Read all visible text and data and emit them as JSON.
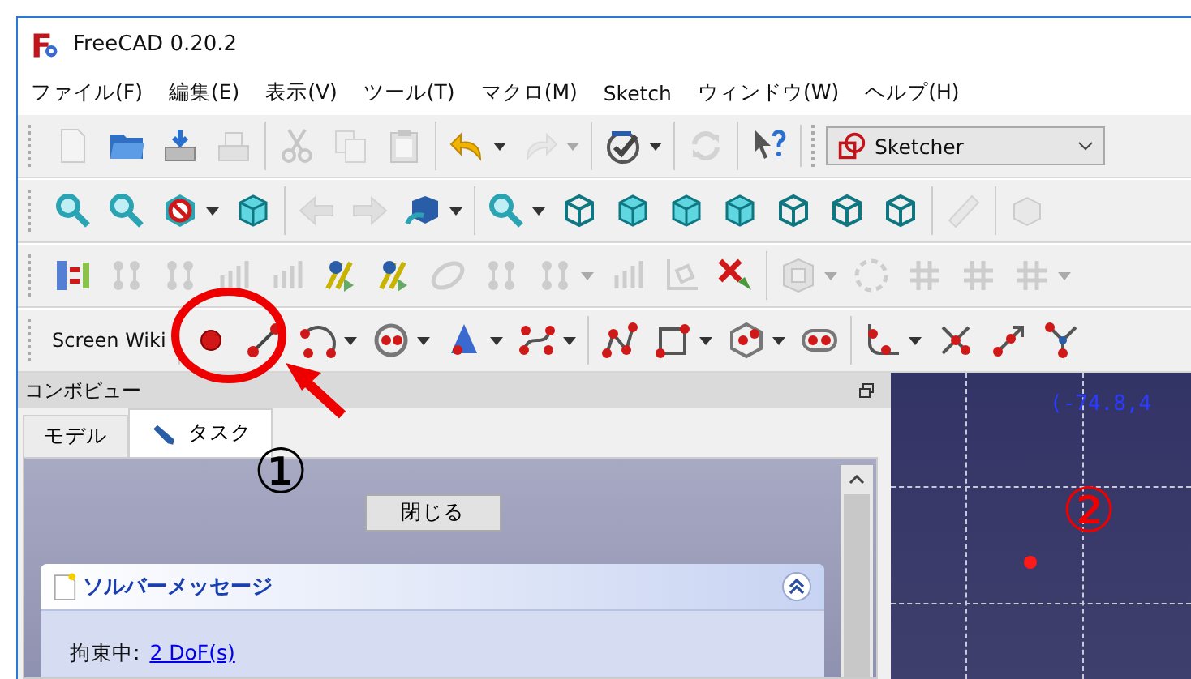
{
  "window": {
    "title": "FreeCAD 0.20.2"
  },
  "menu": [
    "ファイル(F)",
    "編集(E)",
    "表示(V)",
    "ツール(T)",
    "マクロ(M)",
    "Sketch",
    "ウィンドウ(W)",
    "ヘルプ(H)"
  ],
  "toolbars": [
    {
      "groups": [
        [
          {
            "disabled": true,
            "dropdown": false
          },
          {
            "disabled": false,
            "dropdown": false
          },
          {
            "disabled": false,
            "dropdown": false
          },
          {
            "disabled": true,
            "dropdown": false
          }
        ],
        [
          {
            "disabled": true,
            "dropdown": false
          },
          {
            "disabled": true,
            "dropdown": false
          },
          {
            "disabled": true,
            "dropdown": false
          }
        ],
        [
          {
            "disabled": false,
            "dropdown": true
          },
          {
            "disabled": true,
            "dropdown": true
          }
        ],
        [
          {
            "disabled": false,
            "dropdown": true
          }
        ],
        [
          {
            "disabled": true,
            "dropdown": false
          }
        ],
        [
          {
            "disabled": false,
            "dropdown": false
          }
        ]
      ]
    },
    {
      "groups": [
        [
          {
            "disabled": false,
            "dropdown": false
          },
          {
            "disabled": false,
            "dropdown": false
          },
          {
            "disabled": false,
            "dropdown": true
          },
          {
            "disabled": false,
            "dropdown": false
          }
        ],
        [
          {
            "disabled": true,
            "dropdown": false
          },
          {
            "disabled": true,
            "dropdown": false
          },
          {
            "disabled": false,
            "dropdown": true
          }
        ],
        [
          {
            "disabled": false,
            "dropdown": true
          },
          {
            "disabled": false,
            "dropdown": false
          },
          {
            "disabled": false,
            "dropdown": false
          },
          {
            "disabled": false,
            "dropdown": false
          },
          {
            "disabled": false,
            "dropdown": false
          },
          {
            "disabled": false,
            "dropdown": false
          },
          {
            "disabled": false,
            "dropdown": false
          },
          {
            "disabled": false,
            "dropdown": false
          }
        ],
        [
          {
            "disabled": true,
            "dropdown": false
          }
        ],
        [
          {
            "disabled": true,
            "dropdown": false
          }
        ]
      ]
    },
    {
      "groups": [
        [
          {
            "disabled": false,
            "dropdown": false
          },
          {
            "disabled": true,
            "dropdown": false
          },
          {
            "disabled": true,
            "dropdown": false
          },
          {
            "disabled": true,
            "dropdown": false
          },
          {
            "disabled": true,
            "dropdown": false
          },
          {
            "disabled": false,
            "dropdown": false
          },
          {
            "disabled": false,
            "dropdown": false
          },
          {
            "disabled": true,
            "dropdown": false
          },
          {
            "disabled": true,
            "dropdown": false
          },
          {
            "disabled": true,
            "dropdown": true
          },
          {
            "disabled": true,
            "dropdown": false
          },
          {
            "disabled": true,
            "dropdown": false
          },
          {
            "disabled": false,
            "dropdown": false
          }
        ],
        [
          {
            "disabled": true,
            "dropdown": true
          },
          {
            "disabled": true,
            "dropdown": false
          },
          {
            "disabled": true,
            "dropdown": false
          },
          {
            "disabled": true,
            "dropdown": false
          },
          {
            "disabled": true,
            "dropdown": true
          }
        ]
      ]
    },
    {
      "label": "Screen Wiki",
      "groups": [
        [
          {
            "disabled": false,
            "dropdown": false
          },
          {
            "disabled": false,
            "dropdown": false
          },
          {
            "disabled": false,
            "dropdown": true
          },
          {
            "disabled": false,
            "dropdown": true
          },
          {
            "disabled": false,
            "dropdown": true
          },
          {
            "disabled": false,
            "dropdown": true
          }
        ],
        [
          {
            "disabled": false,
            "dropdown": false
          },
          {
            "disabled": false,
            "dropdown": true
          },
          {
            "disabled": false,
            "dropdown": true
          },
          {
            "disabled": false,
            "dropdown": false
          }
        ],
        [
          {
            "disabled": false,
            "dropdown": true
          },
          {
            "disabled": false,
            "dropdown": false
          },
          {
            "disabled": false,
            "dropdown": false
          },
          {
            "disabled": false,
            "dropdown": false
          }
        ]
      ]
    }
  ],
  "workbench": "Sketcher",
  "combo_view": {
    "title": "コンボビュー",
    "tabs": [
      {
        "label": "モデル",
        "selected": false
      },
      {
        "label": "タスク",
        "selected": true
      }
    ],
    "close_button": "閉じる",
    "solver": {
      "title": "ソルバーメッセージ",
      "expanded": true,
      "status_label": "拘束中:",
      "dof_link": "2 DoF(s)"
    }
  },
  "view_3d": {
    "coordinates": "(-74.8,4"
  },
  "annotations": [
    "①",
    "②"
  ]
}
